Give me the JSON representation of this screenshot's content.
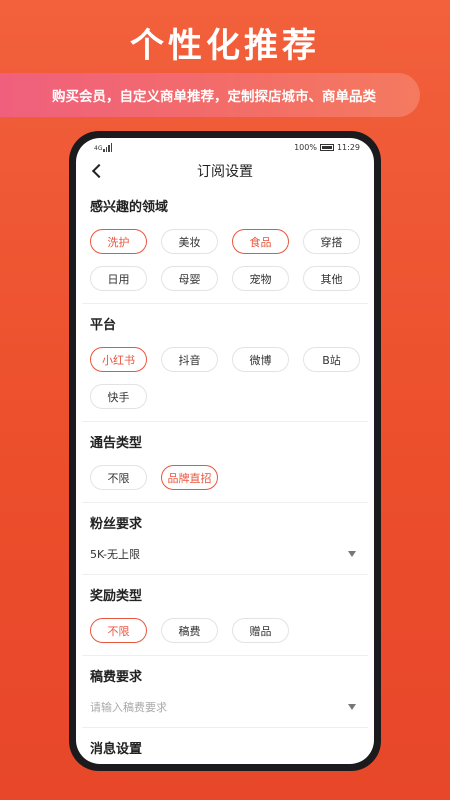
{
  "promo": {
    "headline": "个性化推荐",
    "subtitle": "购买会员，自定义商单推荐，定制探店城市、商单品类"
  },
  "status_bar": {
    "network": "4G",
    "battery": "100%",
    "time": "11:29"
  },
  "nav": {
    "title": "订阅设置",
    "back_icon": "chevron-left-icon"
  },
  "sections": {
    "fields": {
      "title": "感兴趣的领域",
      "options": [
        {
          "label": "洗护",
          "selected": true
        },
        {
          "label": "美妆",
          "selected": false
        },
        {
          "label": "食品",
          "selected": true
        },
        {
          "label": "穿搭",
          "selected": false
        },
        {
          "label": "日用",
          "selected": false
        },
        {
          "label": "母婴",
          "selected": false
        },
        {
          "label": "宠物",
          "selected": false
        },
        {
          "label": "其他",
          "selected": false
        }
      ]
    },
    "platform": {
      "title": "平台",
      "options": [
        {
          "label": "小红书",
          "selected": true
        },
        {
          "label": "抖音",
          "selected": false
        },
        {
          "label": "微博",
          "selected": false
        },
        {
          "label": "B站",
          "selected": false
        },
        {
          "label": "快手",
          "selected": false
        }
      ]
    },
    "notice_type": {
      "title": "通告类型",
      "options": [
        {
          "label": "不限",
          "selected": false
        },
        {
          "label": "品牌直招",
          "selected": true
        }
      ]
    },
    "followers": {
      "title": "粉丝要求",
      "value": "5K-无上限"
    },
    "reward": {
      "title": "奖励类型",
      "options": [
        {
          "label": "不限",
          "selected": true
        },
        {
          "label": "稿费",
          "selected": false
        },
        {
          "label": "赠品",
          "selected": false
        }
      ]
    },
    "fee": {
      "title": "稿费要求",
      "placeholder": "请输入稿费要求"
    },
    "message": {
      "title": "消息设置"
    }
  },
  "colors": {
    "accent": "#e9563e",
    "background": "#ec4f2c"
  }
}
